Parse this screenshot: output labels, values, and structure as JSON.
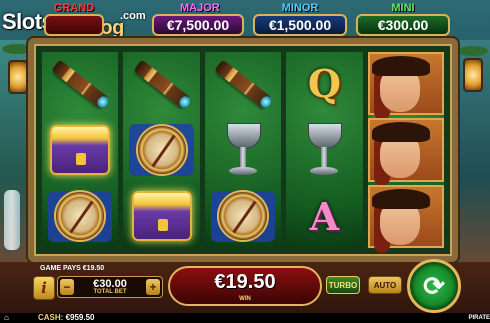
{
  "logo": {
    "slots": "Slots",
    "dotcom": ".com",
    "catalog": "Catalog"
  },
  "jackpots": {
    "grand": {
      "name": "GRAND",
      "value": ""
    },
    "major": {
      "name": "MAJOR",
      "value": "€7,500.00"
    },
    "minor": {
      "name": "MINOR",
      "value": "€1,500.00"
    },
    "mini": {
      "name": "MINI",
      "value": "€300.00"
    }
  },
  "reels": [
    [
      "telescope-symbol",
      "treasure-chest-symbol",
      "compass-symbol"
    ],
    [
      "telescope-symbol",
      "compass-symbol",
      "treasure-chest-symbol"
    ],
    [
      "telescope-symbol",
      "goblet-symbol",
      "compass-symbol"
    ],
    [
      "Q",
      "goblet-symbol",
      "A"
    ],
    [
      "pirate-woman-symbol",
      "pirate-woman-symbol",
      "pirate-woman-symbol"
    ]
  ],
  "footer": {
    "game_pays": "GAME PAYS €19.50",
    "info_label": "i",
    "bet_value": "€30.00",
    "bet_label": "TOTAL BET",
    "minus": "−",
    "plus": "+",
    "win_value": "€19.50",
    "win_label": "WIN",
    "turbo": "TURBO",
    "auto": "AUTO",
    "cash_label": "CASH:",
    "cash_value": "€959.50",
    "provider": "PIRATE"
  },
  "icons": {
    "spin": "spin-arrows-icon",
    "home": "home-icon"
  },
  "colors": {
    "grand": "#ff3a3a",
    "major": "#ff69ff",
    "minor": "#55c8ff",
    "mini": "#62e862",
    "accent": "#e6b85a"
  }
}
